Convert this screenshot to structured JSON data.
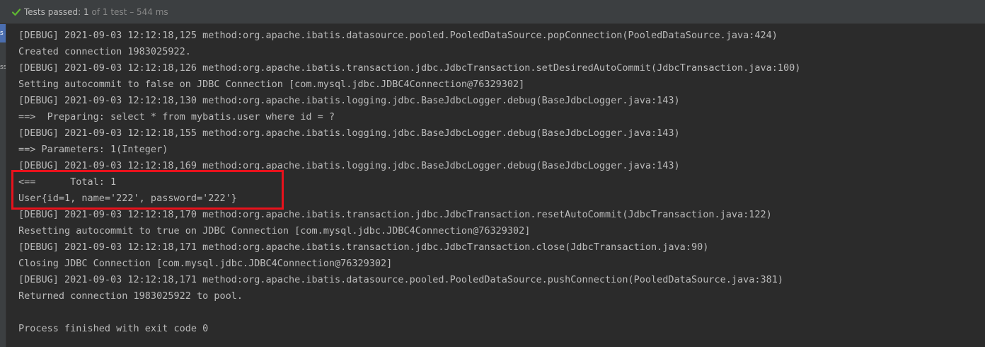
{
  "status": {
    "passed_label": "Tests passed:",
    "count": "1",
    "summary": "of 1 test – 544 ms"
  },
  "gutter": {
    "tab_1": "s",
    "tab_2": "ss"
  },
  "console_lines": [
    "[DEBUG] 2021-09-03 12:12:18,125 method:org.apache.ibatis.datasource.pooled.PooledDataSource.popConnection(PooledDataSource.java:424)",
    "Created connection 1983025922.",
    "[DEBUG] 2021-09-03 12:12:18,126 method:org.apache.ibatis.transaction.jdbc.JdbcTransaction.setDesiredAutoCommit(JdbcTransaction.java:100)",
    "Setting autocommit to false on JDBC Connection [com.mysql.jdbc.JDBC4Connection@76329302]",
    "[DEBUG] 2021-09-03 12:12:18,130 method:org.apache.ibatis.logging.jdbc.BaseJdbcLogger.debug(BaseJdbcLogger.java:143)",
    "==>  Preparing: select * from mybatis.user where id = ?",
    "[DEBUG] 2021-09-03 12:12:18,155 method:org.apache.ibatis.logging.jdbc.BaseJdbcLogger.debug(BaseJdbcLogger.java:143)",
    "==> Parameters: 1(Integer)",
    "[DEBUG] 2021-09-03 12:12:18,169 method:org.apache.ibatis.logging.jdbc.BaseJdbcLogger.debug(BaseJdbcLogger.java:143)",
    "<==      Total: 1",
    "User{id=1, name='222', password='222'}",
    "[DEBUG] 2021-09-03 12:12:18,170 method:org.apache.ibatis.transaction.jdbc.JdbcTransaction.resetAutoCommit(JdbcTransaction.java:122)",
    "Resetting autocommit to true on JDBC Connection [com.mysql.jdbc.JDBC4Connection@76329302]",
    "[DEBUG] 2021-09-03 12:12:18,171 method:org.apache.ibatis.transaction.jdbc.JdbcTransaction.close(JdbcTransaction.java:90)",
    "Closing JDBC Connection [com.mysql.jdbc.JDBC4Connection@76329302]",
    "[DEBUG] 2021-09-03 12:12:18,171 method:org.apache.ibatis.datasource.pooled.PooledDataSource.pushConnection(PooledDataSource.java:381)",
    "Returned connection 1983025922 to pool.",
    "",
    "Process finished with exit code 0"
  ],
  "colors": {
    "background": "#2b2b2b",
    "toolbar": "#3c3f41",
    "text": "#bbbbbb",
    "success": "#5fb832",
    "highlight": "#e8121c"
  }
}
